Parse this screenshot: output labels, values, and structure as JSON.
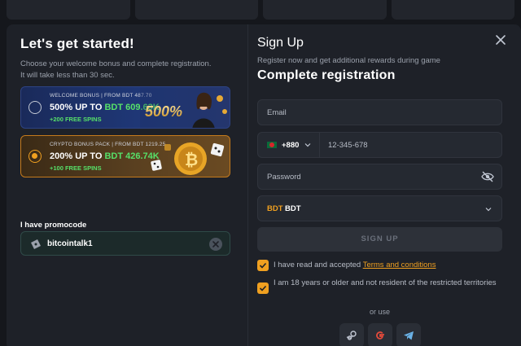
{
  "left": {
    "title": "Let's get started!",
    "subtitle_line1": "Choose your welcome bonus and complete registration.",
    "subtitle_line2": "It will take less than 30 sec.",
    "bonuses": [
      {
        "tag": "WELCOME BONUS | FROM BDT 487.70",
        "amount_prefix": "500% UP TO",
        "amount_highlight": "BDT 609.63K",
        "spins": "+200 FREE SPINS",
        "art_text": "500%",
        "selected": false
      },
      {
        "tag": "CRYPTO BONUS PACK | FROM BDT 1219.25",
        "amount_prefix": "200% UP TO",
        "amount_highlight": "BDT 426.74K",
        "spins": "+100 FREE SPINS",
        "selected": true
      }
    ],
    "promo_label": "I have promocode",
    "promo_value": "bitcointalk1"
  },
  "right": {
    "title": "Sign Up",
    "subtitle": "Register now and get additional rewards during game",
    "heading": "Complete registration",
    "email_placeholder": "Email",
    "phone_code": "+880",
    "phone_placeholder": "12-345-678",
    "password_placeholder": "Password",
    "currency_code": "BDT",
    "currency_name": "BDT",
    "signup_label": "SIGN UP",
    "terms_prefix": "I have read and accepted ",
    "terms_link": "Terms and conditions",
    "age_text": "I am 18 years or older and not resident of the restricted territories",
    "or_use": "or use"
  },
  "colors": {
    "accent": "#f0a020",
    "highlight_green": "#56e069",
    "background": "#1e2128"
  },
  "icons": [
    "close-icon",
    "ticket-icon",
    "clear-icon",
    "chevron-down-icon",
    "eye-off-icon",
    "check-icon",
    "steam-icon",
    "google-icon",
    "telegram-icon"
  ]
}
